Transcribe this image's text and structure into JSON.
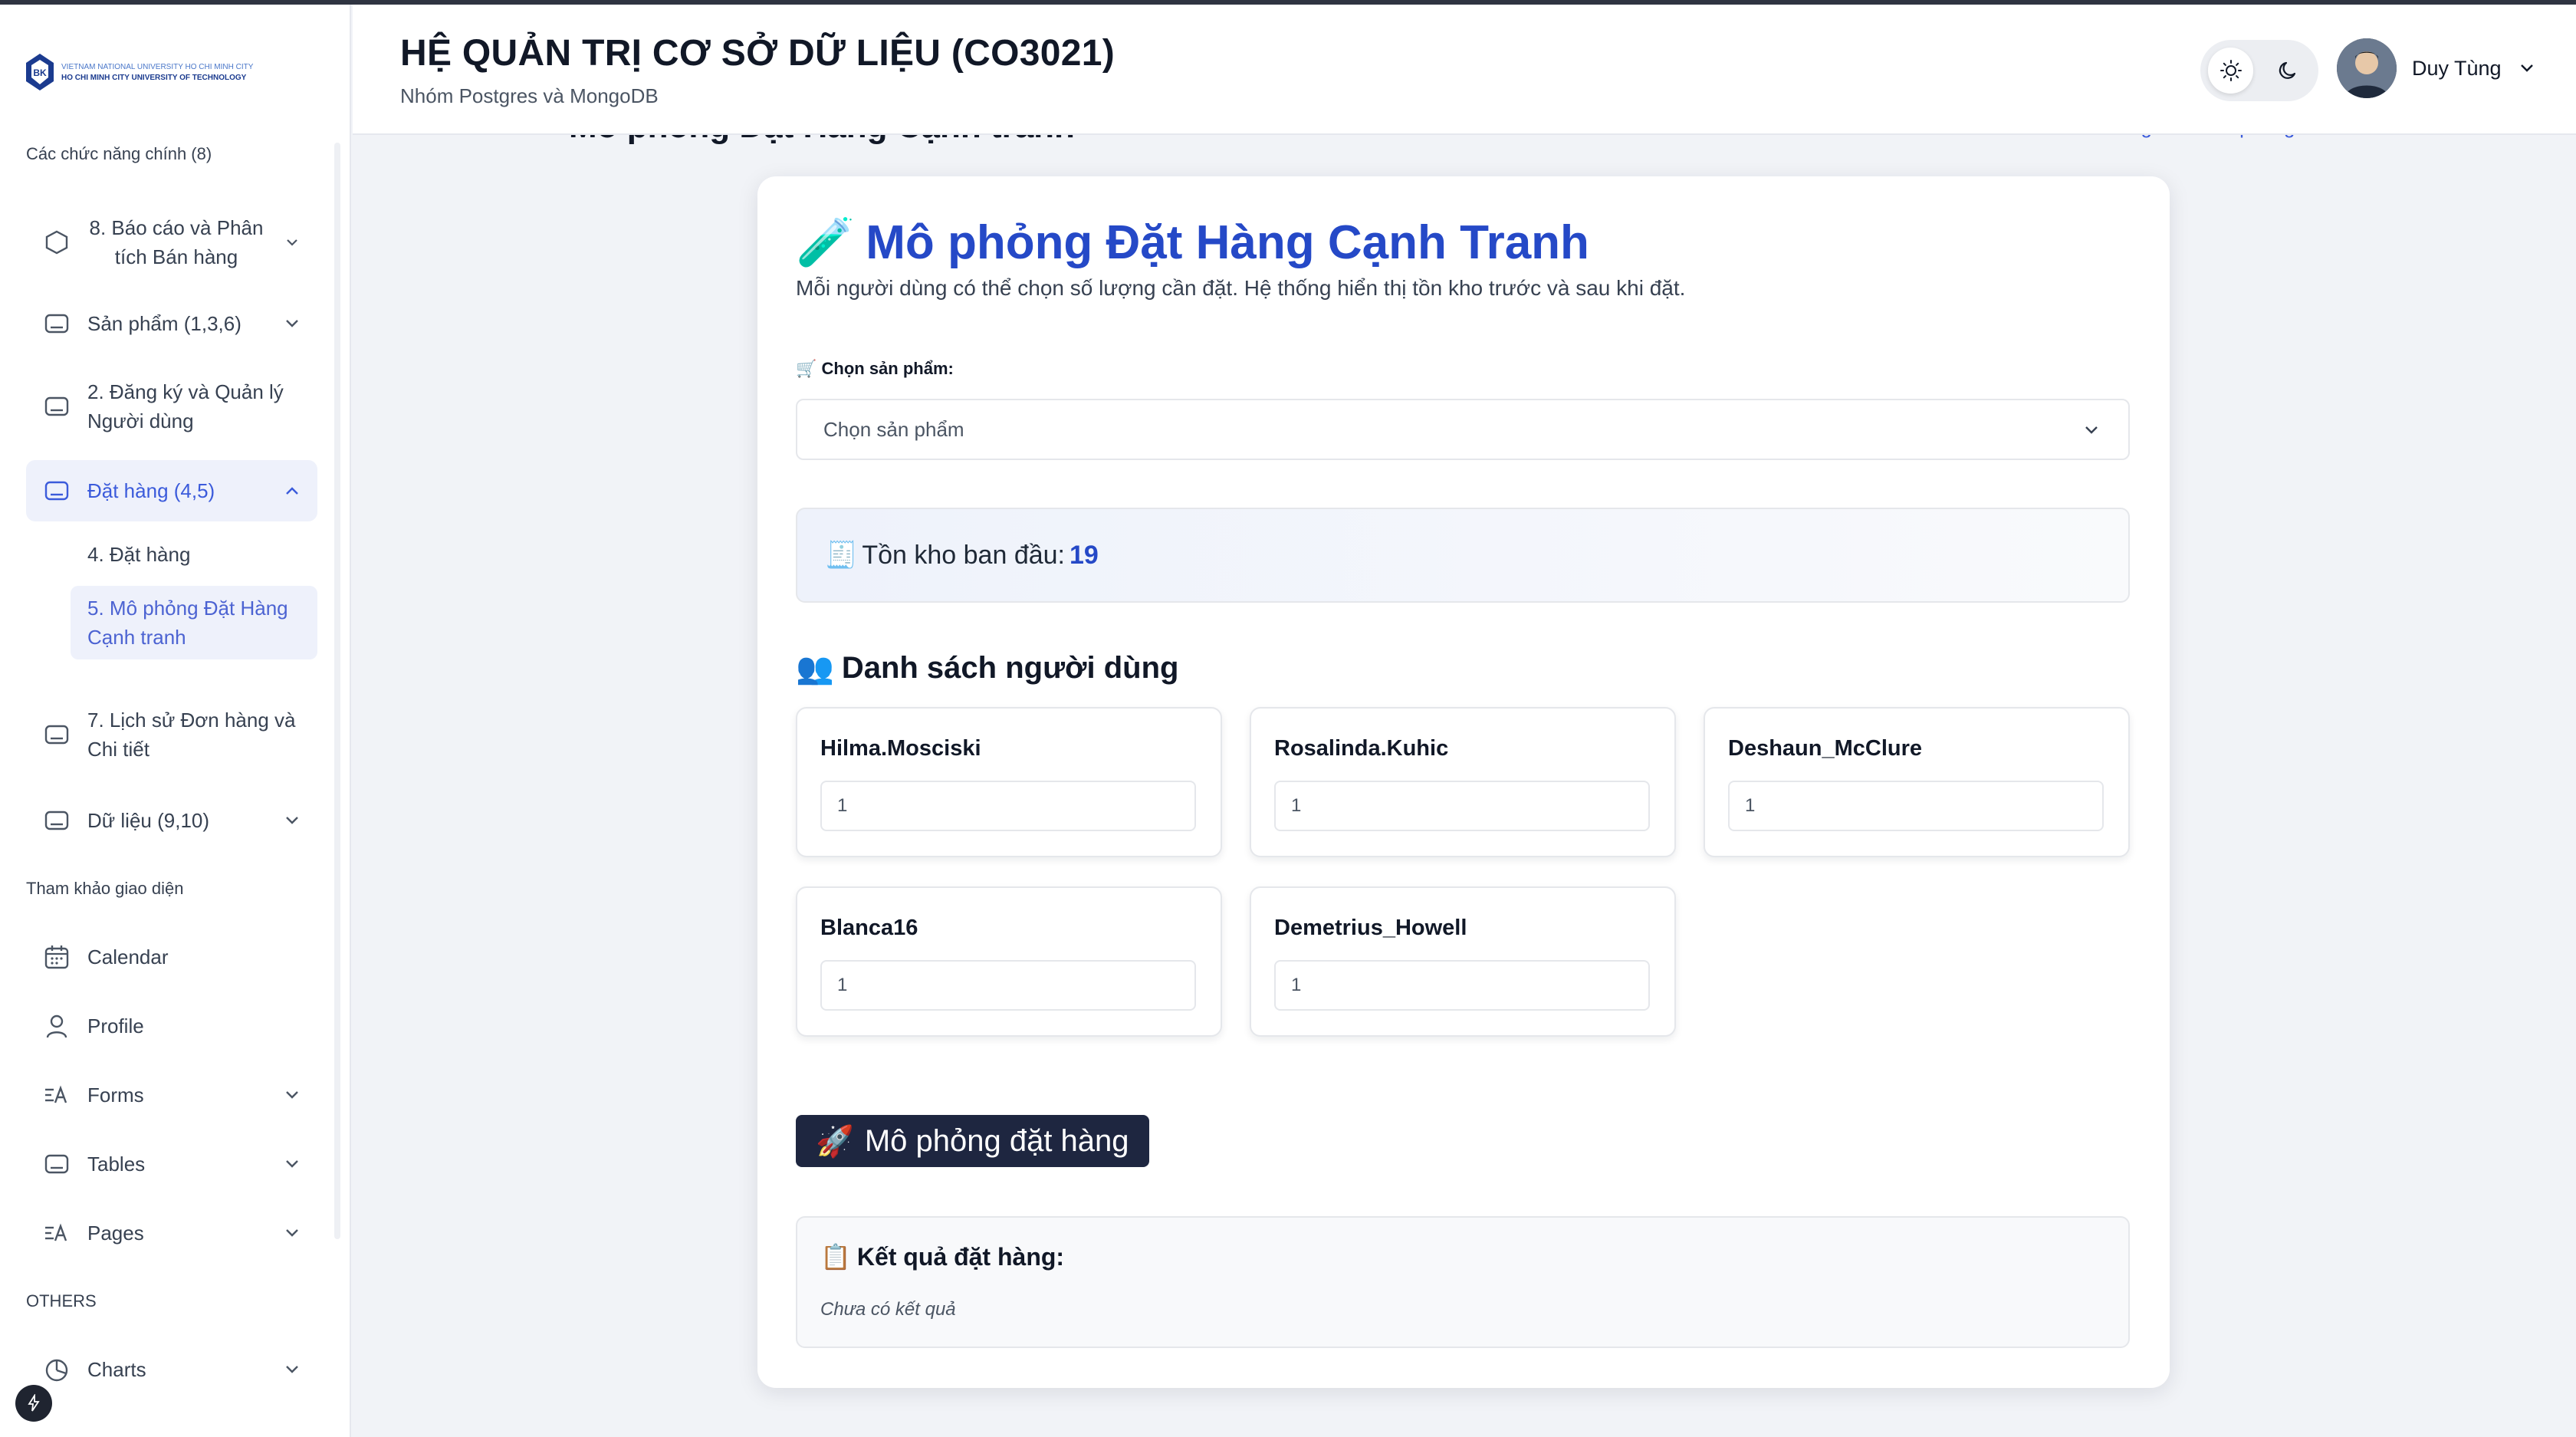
{
  "header": {
    "title": "HỆ QUẢN TRỊ CƠ SỞ DỮ LIỆU (CO3021)",
    "subtitle": "Nhóm Postgres và MongoDB",
    "user_name": "Duy Tùng"
  },
  "logo": {
    "line1": "VIETNAM NATIONAL UNIVERSITY HO CHI MINH CITY",
    "line2": "HO CHI MINH CITY UNIVERSITY OF TECHNOLOGY"
  },
  "sidebar": {
    "section_main": "Các chức năng chính (8)",
    "items": [
      {
        "label": "8. Báo cáo và Phân tích Bán hàng"
      },
      {
        "label": "Sản phẩm (1,3,6)"
      },
      {
        "label": "2. Đăng ký và Quản lý Người dùng"
      },
      {
        "label": "Đặt hàng (4,5)"
      },
      {
        "label": "7. Lịch sử Đơn hàng và Chi tiết"
      },
      {
        "label": "Dữ liệu (9,10)"
      }
    ],
    "sub_items": [
      {
        "label": "4. Đặt hàng"
      },
      {
        "label": "5. Mô phỏng Đặt Hàng Cạnh tranh"
      }
    ],
    "section_ref": "Tham khảo giao diện",
    "ref_items": [
      {
        "label": "Calendar"
      },
      {
        "label": "Profile"
      },
      {
        "label": "Forms"
      },
      {
        "label": "Tables"
      },
      {
        "label": "Pages"
      }
    ],
    "section_others": "OTHERS",
    "other_items": [
      {
        "label": "Charts"
      }
    ]
  },
  "page": {
    "behind_title": "Mô phỏng Đặt Hàng Cạnh tranh",
    "behind_link": "Trang chủ / Mô phỏng"
  },
  "card": {
    "title_icon": "🧪",
    "title": "Mô phỏng Đặt Hàng Cạnh Tranh",
    "description": "Mỗi người dùng có thể chọn số lượng cần đặt. Hệ thống hiển thị tồn kho trước và sau khi đặt.",
    "select_label": "🛒 Chọn sản phẩm:",
    "select_placeholder": "Chọn sản phẩm",
    "stock_icon": "🧾",
    "stock_label": "Tồn kho ban đầu:",
    "stock_value": "19",
    "users_icon": "👥",
    "users_heading": "Danh sách người dùng",
    "users": [
      {
        "name": "Hilma.Mosciski",
        "qty": "1"
      },
      {
        "name": "Rosalinda.Kuhic",
        "qty": "1"
      },
      {
        "name": "Deshaun_McClure",
        "qty": "1"
      },
      {
        "name": "Blanca16",
        "qty": "1"
      },
      {
        "name": "Demetrius_Howell",
        "qty": "1"
      }
    ],
    "simulate_icon": "🚀",
    "simulate_label": "Mô phỏng đặt hàng",
    "result_icon": "📋",
    "result_heading": "Kết quả đặt hàng:",
    "result_text": "Chưa có kết quả"
  },
  "colors": {
    "accent": "#2549c7",
    "sidebar_active_bg": "#eef1fb",
    "button_dark": "#1e2640"
  },
  "icons": {
    "sun": "sun-icon",
    "moon": "moon-icon",
    "chevron": "chevron-down-icon",
    "calendar": "calendar-icon",
    "profile": "user-icon",
    "forms": "forms-icon",
    "tables": "table-icon",
    "pages": "pages-icon",
    "charts": "pie-chart-icon"
  }
}
